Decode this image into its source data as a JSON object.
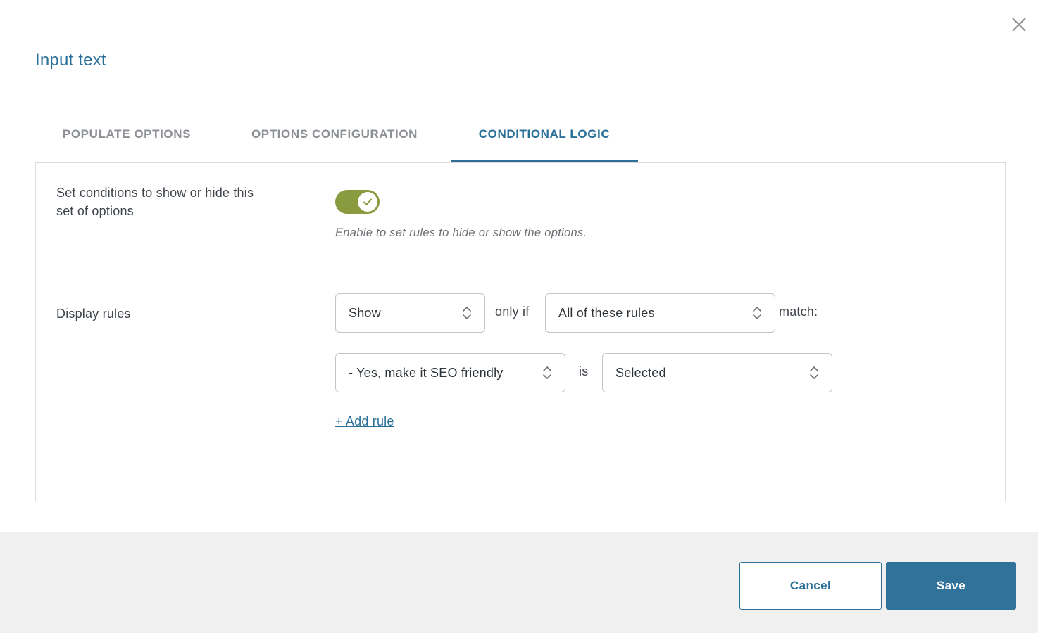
{
  "dialog": {
    "title": "Input text",
    "close_icon": "close-icon"
  },
  "tabs": [
    {
      "label": "POPULATE OPTIONS",
      "active": false
    },
    {
      "label": "OPTIONS CONFIGURATION",
      "active": false
    },
    {
      "label": "CONDITIONAL LOGIC",
      "active": true
    }
  ],
  "conditions": {
    "label": "Set conditions to show or hide this set of options",
    "toggle_on": true,
    "helper": "Enable to set rules to hide or show the options."
  },
  "display_rules": {
    "label": "Display rules",
    "action_value": "Show",
    "only_if_text": "only if",
    "match_mode_value": "All of these rules",
    "match_text": "match:",
    "rule": {
      "field_value": "- Yes, make it SEO friendly",
      "is_text": "is",
      "state_value": "Selected"
    },
    "add_rule_label": "+ Add rule"
  },
  "footer": {
    "cancel_label": "Cancel",
    "save_label": "Save"
  },
  "colors": {
    "accent": "#2a6f97",
    "toggle_on": "#8a9a3e",
    "save_button": "#31729a",
    "footer_bg": "#f0f0f1"
  }
}
